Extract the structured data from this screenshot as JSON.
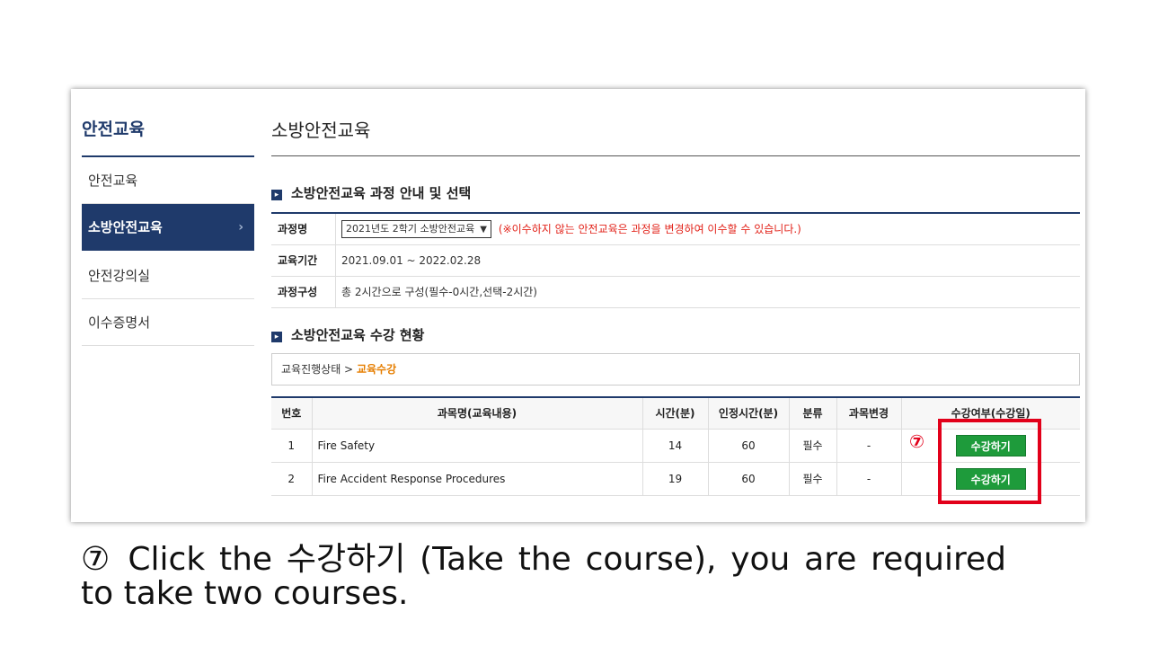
{
  "sidebar": {
    "title": "안전교육",
    "items": [
      {
        "label": "안전교육",
        "active": false
      },
      {
        "label": "소방안전교육",
        "active": true,
        "chevron": "›"
      },
      {
        "label": "안전강의실",
        "active": false
      },
      {
        "label": "이수증명서",
        "active": false
      }
    ]
  },
  "main": {
    "title": "소방안전교육",
    "section1": {
      "icon": "▸",
      "title": "소방안전교육 과정 안내 및 선택"
    },
    "info": {
      "course_label": "과정명",
      "course_value": "2021년도 2학기 소방안전교육",
      "course_notice": "(※이수하지 않는 안전교육은 과정을 변경하여 이수할 수 있습니다.)",
      "period_label": "교육기간",
      "period_value": "2021.09.01 ~ 2022.02.28",
      "composition_label": "과정구성",
      "composition_value": "총 2시간으로 구성(필수-0시간,선택-2시간)"
    },
    "section2": {
      "icon": "▸",
      "title": "소방안전교육 수강 현황"
    },
    "status": {
      "prefix": "교육진행상태 >",
      "current": "교육수강"
    },
    "table": {
      "headers": [
        "번호",
        "과목명(교육내용)",
        "시간(분)",
        "인정시간(분)",
        "분류",
        "과목변경",
        "수강여부(수강일)"
      ],
      "rows": [
        {
          "no": "1",
          "name": "Fire Safety",
          "time": "14",
          "credit": "60",
          "category": "필수",
          "change": "-",
          "action": "수강하기"
        },
        {
          "no": "2",
          "name": "Fire Accident Response Procedures",
          "time": "19",
          "credit": "60",
          "category": "필수",
          "change": "-",
          "action": "수강하기"
        }
      ]
    }
  },
  "annotation": {
    "step_marker": "⑦",
    "highlight_color": "#e2001a"
  },
  "caption": "⑦ Click  the 수강하기 (Take the course), you are required to take two courses."
}
